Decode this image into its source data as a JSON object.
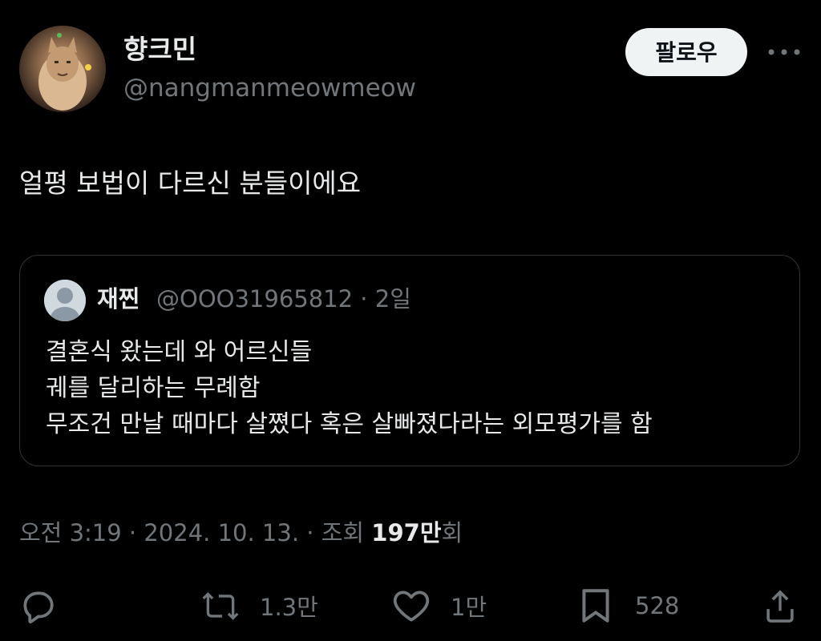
{
  "author": {
    "display_name": "향크민",
    "handle": "@nangmanmeowmeow",
    "follow_label": "팔로우"
  },
  "tweet": {
    "text": "얼평 보법이 다르신 분들이에요"
  },
  "quote": {
    "display_name": "재찐",
    "handle_time": "@OOO31965812 · 2일",
    "lines": [
      "결혼식 왔는데 와 어르신들",
      "궤를 달리하는 무례함",
      "무조건 만날 때마다 살쪘다 혹은 살빠졌다라는 외모평가를 함"
    ]
  },
  "meta": {
    "time_date": "오전 3:19 · 2024. 10. 13. · 조회 ",
    "views_count": "197만",
    "views_suffix": "회"
  },
  "actions": {
    "reply_icon": "reply-icon",
    "retweet_icon": "retweet-icon",
    "retweet_count": "1.3만",
    "like_icon": "heart-icon",
    "like_count": "1만",
    "bookmark_icon": "bookmark-icon",
    "bookmark_count": "528",
    "share_icon": "share-icon"
  },
  "colors": {
    "background": "#000000",
    "primary_text": "#e7e9ea",
    "secondary_text": "#71767b",
    "border": "#2f3336",
    "follow_bg": "#eff3f4"
  }
}
